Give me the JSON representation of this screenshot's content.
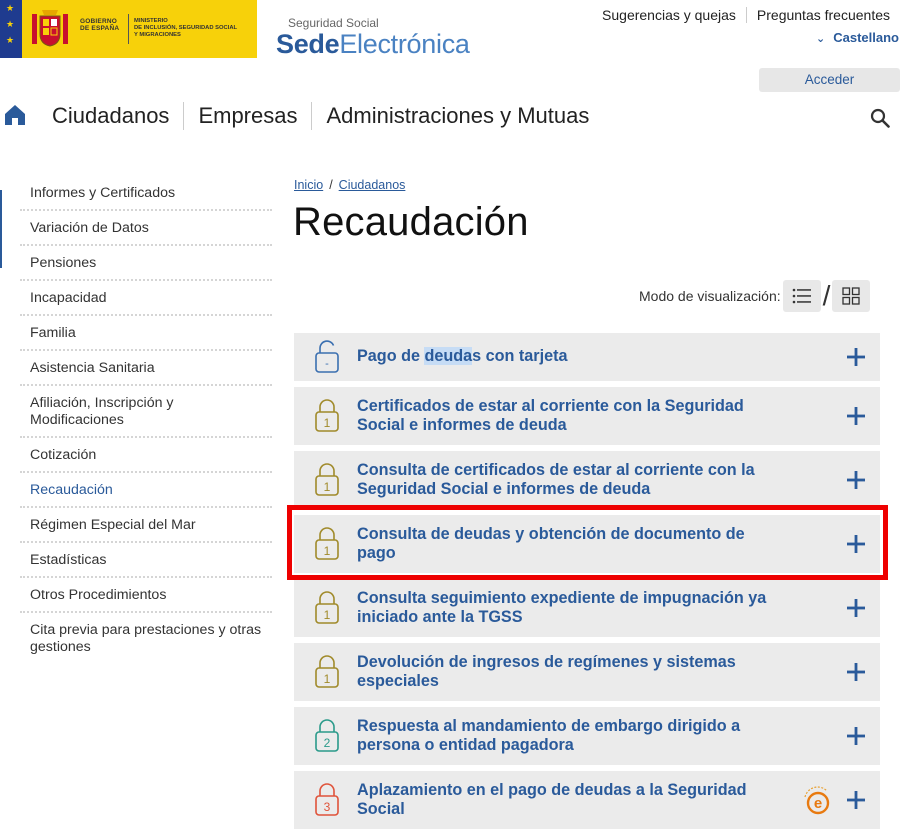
{
  "header": {
    "gov_text": "GOBIERNO\nDE ESPAÑA",
    "ministry_text": "MINISTERIO\nDE INCLUSIÓN, SEGURIDAD SOCIAL\nY MIGRACIONES",
    "sede_small": "Seguridad Social",
    "sede_bold": "Sede",
    "sede_light": "Electrónica",
    "top_links": [
      "Sugerencias y quejas",
      "Preguntas frecuentes"
    ],
    "language": "Castellano",
    "login_label": "Acceder"
  },
  "nav": {
    "items": [
      "Ciudadanos",
      "Empresas",
      "Administraciones y Mutuas"
    ]
  },
  "sidebar": {
    "items": [
      {
        "label": "Informes y Certificados"
      },
      {
        "label": "Variación de Datos"
      },
      {
        "label": "Pensiones"
      },
      {
        "label": "Incapacidad"
      },
      {
        "label": "Familia"
      },
      {
        "label": "Asistencia Sanitaria"
      },
      {
        "label": "Afiliación, Inscripción y Modificaciones"
      },
      {
        "label": "Cotización"
      },
      {
        "label": "Recaudación"
      },
      {
        "label": "Régimen Especial del Mar"
      },
      {
        "label": "Estadísticas"
      },
      {
        "label": "Otros Procedimientos"
      },
      {
        "label": "Cita previa para prestaciones y otras gestiones"
      }
    ],
    "active": "Recaudación"
  },
  "breadcrumb": {
    "home": "Inicio",
    "separator": "/",
    "current": "Ciudadanos"
  },
  "page_title": "Recaudación",
  "view_mode": {
    "label": "Modo de visualización:",
    "separator": "/"
  },
  "services": [
    {
      "pre": "Pago de ",
      "highlight": "deuda",
      "post": "s con tarjeta",
      "level": "-",
      "color": "#3a6fb0"
    },
    {
      "pre": "Certificados de estar al corriente con la Seguridad Social e informes de deuda",
      "highlight": "",
      "post": "",
      "level": "1",
      "color": "#a08a2a"
    },
    {
      "pre": "Consulta de certificados de estar al corriente con la Seguridad Social e informes de deuda",
      "highlight": "",
      "post": "",
      "level": "1",
      "color": "#a08a2a"
    },
    {
      "pre": "Consulta de deudas y obtención de documento de pago",
      "highlight": "",
      "post": "",
      "level": "1",
      "color": "#a08a2a"
    },
    {
      "pre": "Consulta seguimiento expediente de impugnación ya iniciado ante la TGSS",
      "highlight": "",
      "post": "",
      "level": "1",
      "color": "#a08a2a"
    },
    {
      "pre": "Devolución de ingresos de regímenes y sistemas especiales",
      "highlight": "",
      "post": "",
      "level": "1",
      "color": "#a08a2a"
    },
    {
      "pre": "Respuesta al mandamiento de embargo dirigido a persona o entidad pagadora",
      "highlight": "",
      "post": "",
      "level": "2",
      "color": "#2a9a8a"
    },
    {
      "pre": "Aplazamiento en el pago de deudas a la Seguridad Social",
      "highlight": "",
      "post": "",
      "level": "3",
      "color": "#e0533a",
      "badge": "e"
    }
  ],
  "colors": {
    "accent": "#2a5a9a",
    "highlight_box": "#ee0000",
    "row_bg": "#ebebeb"
  }
}
